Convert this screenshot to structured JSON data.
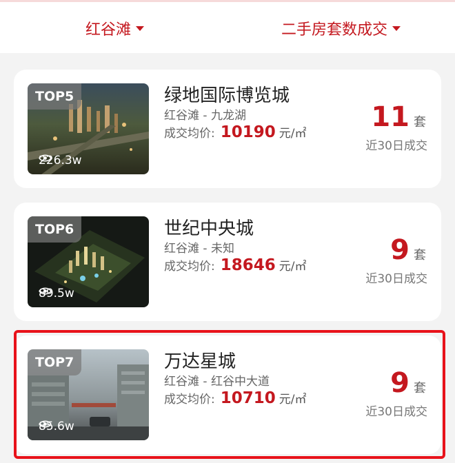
{
  "filters": {
    "area": "红谷滩",
    "sort": "二手房套数成交"
  },
  "colors": {
    "accent": "#c4181f",
    "highlight": "#e8121a"
  },
  "listings": [
    {
      "rank": "TOP5",
      "views": "226.3w",
      "name": "绿地国际博览城",
      "location": "红谷滩 - 九龙湖",
      "price_label": "成交均价:",
      "price": "10190",
      "price_unit": "元/㎡",
      "count": "11",
      "count_unit": "套",
      "period": "近30日成交"
    },
    {
      "rank": "TOP6",
      "views": "89.5w",
      "name": "世纪中央城",
      "location": "红谷滩 - 未知",
      "price_label": "成交均价:",
      "price": "18646",
      "price_unit": "元/㎡",
      "count": "9",
      "count_unit": "套",
      "period": "近30日成交"
    },
    {
      "rank": "TOP7",
      "views": "85.6w",
      "name": "万达星城",
      "location": "红谷滩 - 红谷中大道",
      "price_label": "成交均价:",
      "price": "10710",
      "price_unit": "元/㎡",
      "count": "9",
      "count_unit": "套",
      "period": "近30日成交",
      "highlighted": true
    }
  ]
}
